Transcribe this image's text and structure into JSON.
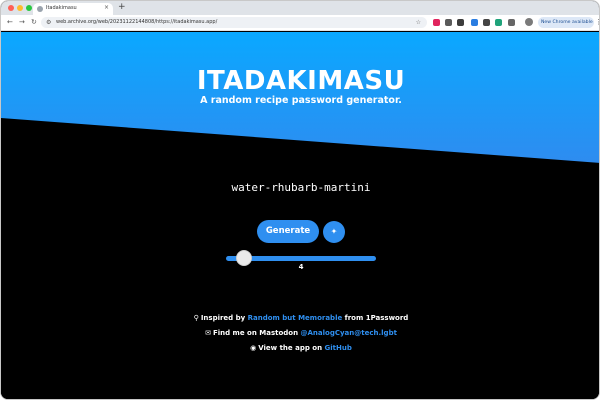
{
  "browser": {
    "tab_title": "Itadakimasu",
    "url": "web.archive.org/web/20231122144808/https://itadakimasu.app/",
    "new_chrome_label": "New Chrome available"
  },
  "hero": {
    "title": "ITADAKIMASU",
    "subtitle": "A random recipe password generator."
  },
  "generator": {
    "password": "water-rhubarb-martini",
    "generate_label": "Generate",
    "options_icon": "sparkle-icon",
    "word_count": 4,
    "word_count_label": "4",
    "slider_fraction": 0.12
  },
  "footer": {
    "line1": {
      "prefix": "Inspired by ",
      "link": "Random but Memorable",
      "suffix": " from 1Password"
    },
    "line2": {
      "prefix": "Find me on Mastodon ",
      "link": "@AnalogCyan@tech.lgbt"
    },
    "line3": {
      "prefix": "View the app on ",
      "link": "GitHub"
    }
  },
  "colors": {
    "accent": "#2f8ff0",
    "hero_gradient_top": "#0aa8ff",
    "hero_gradient_bottom": "#2e8cf0",
    "background": "#000000"
  }
}
